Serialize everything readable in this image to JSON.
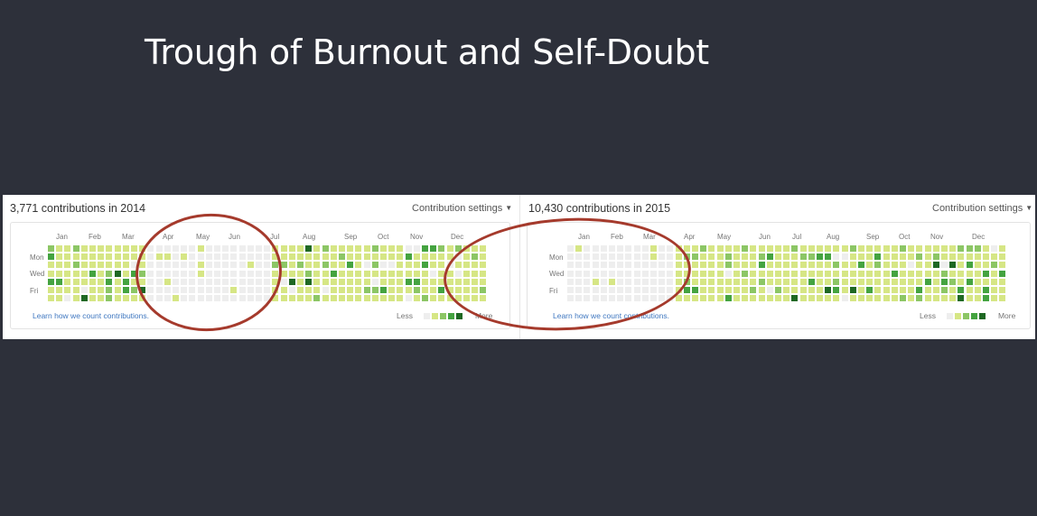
{
  "slide": {
    "title": "Trough of Burnout and Self-Doubt"
  },
  "colors": {
    "background": "#2d303a",
    "annotation_circle": "#a53a2c",
    "link": "#4078c0",
    "levels": [
      "#eeeeee",
      "#d6e685",
      "#8cc665",
      "#44a340",
      "#1e6823"
    ]
  },
  "panels": [
    {
      "title": "3,771 contributions in 2014",
      "settings_label": "Contribution settings",
      "months": [
        "Jan",
        "Feb",
        "Mar",
        "Apr",
        "May",
        "Jun",
        "Jul",
        "Aug",
        "Sep",
        "Oct",
        "Nov",
        "Dec"
      ],
      "day_labels": [
        "Mon",
        "Wed",
        "Fri"
      ],
      "learn_link": "Learn how we count contributions.",
      "legend": {
        "less": "Less",
        "more": "More"
      },
      "activity": {
        "weeks": 53,
        "quiet_weeks": [
          12,
          27
        ],
        "empty_from_week": 53
      }
    },
    {
      "title": "10,430 contributions in 2015",
      "settings_label": "Contribution settings",
      "months": [
        "Jan",
        "Feb",
        "Mar",
        "Apr",
        "May",
        "Jun",
        "Jul",
        "Aug",
        "Sep",
        "Oct",
        "Nov",
        "Dec"
      ],
      "day_labels": [
        "Mon",
        "Wed",
        "Fri"
      ],
      "learn_link": "Learn how we count contributions.",
      "legend": {
        "less": "Less",
        "more": "More"
      },
      "activity": {
        "weeks": 53,
        "quiet_weeks": [
          0,
          13
        ],
        "empty_from_week": 53
      }
    }
  ]
}
